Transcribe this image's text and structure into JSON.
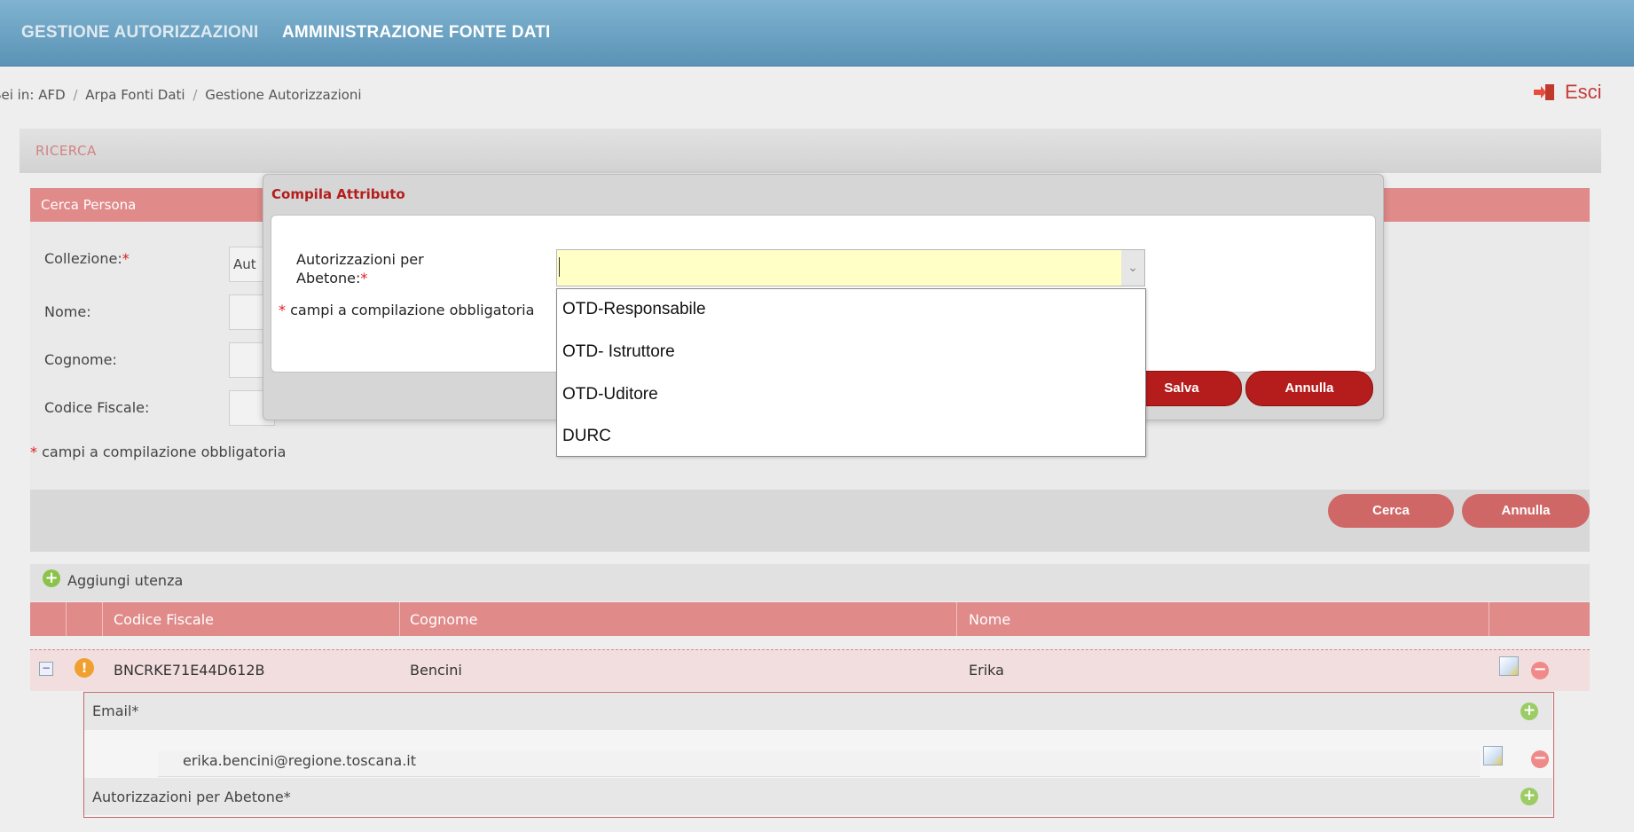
{
  "topnav": {
    "items": [
      {
        "label": "GESTIONE AUTORIZZAZIONI"
      },
      {
        "label": "AMMINISTRAZIONE FONTE DATI"
      }
    ]
  },
  "breadcrumb": {
    "prefix": "Sei in:",
    "items": [
      "AFD",
      "Arpa Fonti Dati",
      "Gestione Autorizzazioni"
    ],
    "separator": "/"
  },
  "header": {
    "exit_label": "Esci"
  },
  "ricerca": {
    "title": "RICERCA"
  },
  "search_panel": {
    "title": "Cerca Persona",
    "fields": [
      {
        "label": "Collezione:",
        "required": "*",
        "value": "Aut"
      },
      {
        "label": "Nome:"
      },
      {
        "label": "Cognome:"
      },
      {
        "label": "Codice Fiscale:"
      }
    ],
    "required_note": "campi a compilazione obbligatoria",
    "required_mark": "*",
    "search_button": "Cerca",
    "cancel_button": "Annulla"
  },
  "users": {
    "add_label": "Aggiungi utenza",
    "columns": [
      "Codice Fiscale",
      "Cognome",
      "Nome"
    ],
    "rows": [
      {
        "codice_fiscale": "BNCRKE71E44D612B",
        "cognome": "Bencini",
        "nome": "Erika"
      }
    ],
    "details": {
      "email_label": "Email*",
      "email_value": "erika.bencini@regione.toscana.it",
      "auth_label": "Autorizzazioni per Abetone*"
    }
  },
  "dialog": {
    "title": "Compila Attributo",
    "field_label_line1": "Autorizzazioni per",
    "field_label_line2": "Abetone:",
    "required_mark": "*",
    "input_value": "",
    "note": "campi a compilazione obbligatoria",
    "save_button": "Salva",
    "cancel_button": "Annulla",
    "options": [
      "OTD-Responsabile",
      "OTD- Istruttore",
      "OTD-Uditore",
      "DURC"
    ]
  },
  "colors": {
    "nav_bg": "#6ea6c6",
    "panel_header": "#e08a8a",
    "button_dark": "#b51c1c",
    "input_highlight": "#ffffc6"
  }
}
